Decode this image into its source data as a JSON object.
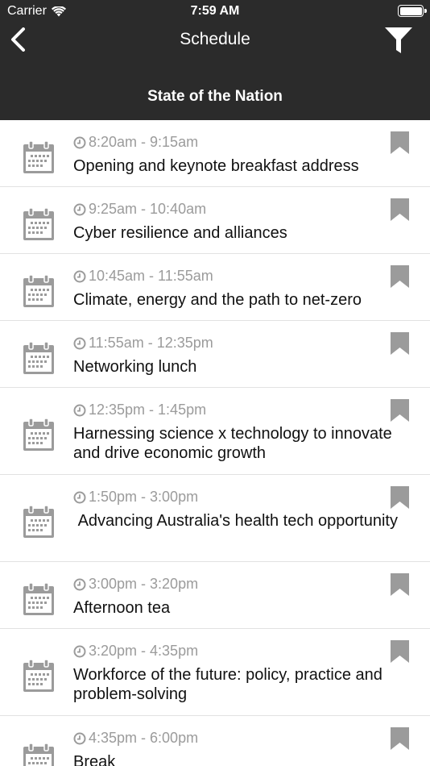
{
  "status": {
    "carrier": "Carrier",
    "time": "7:59 AM"
  },
  "nav": {
    "title": "Schedule",
    "section": "State of the Nation"
  },
  "sessions": [
    {
      "time": "8:20am - 9:15am",
      "title": "Opening and keynote breakfast address"
    },
    {
      "time": "9:25am - 10:40am",
      "title": "Cyber resilience and alliances"
    },
    {
      "time": "10:45am - 11:55am",
      "title": "Climate, energy and the path to net-zero"
    },
    {
      "time": "11:55am - 12:35pm",
      "title": "Networking lunch"
    },
    {
      "time": "12:35pm - 1:45pm",
      "title": "Harnessing science x technology to innovate and drive economic growth"
    },
    {
      "time": "1:50pm - 3:00pm",
      "title": " Advancing Australia's health tech opportunity"
    },
    {
      "time": "3:00pm - 3:20pm",
      "title": "Afternoon tea"
    },
    {
      "time": "3:20pm - 4:35pm",
      "title": "Workforce of the future: policy, practice and problem-solving"
    },
    {
      "time": "4:35pm - 6:00pm",
      "title": "Break"
    }
  ],
  "colors": {
    "header_bg": "#2b2b2b",
    "icon_gray": "#9b9b9b",
    "divider": "#e2e2e2"
  },
  "icons": {
    "back": "chevron-left-icon",
    "filter": "filter-icon",
    "event": "calendar-icon",
    "time": "clock-icon",
    "save": "bookmark-icon"
  }
}
